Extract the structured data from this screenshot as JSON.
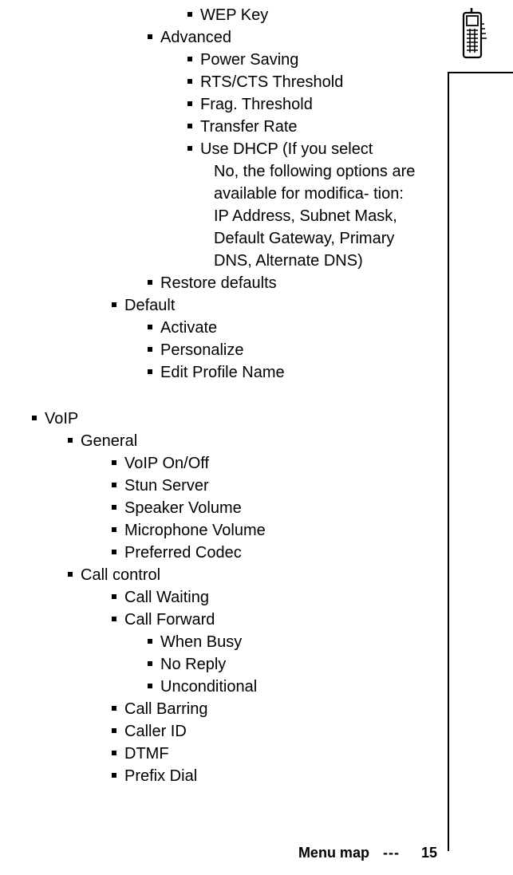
{
  "top": {
    "l4": [
      "WEP Key"
    ],
    "advanced_label": "Advanced",
    "advanced_items": [
      "Power Saving",
      "RTS/CTS Threshold",
      "Frag. Threshold",
      "Transfer Rate"
    ],
    "dhcp_line1": "Use DHCP (If you select",
    "dhcp_cont": [
      "No, the following options are",
      "available for modifica- tion:",
      "IP Address, Subnet Mask,",
      "Default Gateway, Primary",
      "DNS, Alternate DNS)"
    ],
    "restore_label": "Restore defaults",
    "default_label": "Default",
    "default_items": [
      "Activate",
      "Personalize",
      "Edit Profile Name"
    ]
  },
  "voip": {
    "title": "VoIP",
    "general_label": "General",
    "general_items": [
      "VoIP On/Off",
      "Stun Server",
      "Speaker Volume",
      "Microphone Volume",
      "Preferred Codec"
    ],
    "callcontrol_label": "Call control",
    "cc_before": [
      "Call Waiting",
      "Call Forward"
    ],
    "cc_sub": [
      "When Busy",
      "No Reply",
      "Unconditional"
    ],
    "cc_after": [
      "Call Barring",
      "Caller ID",
      "DTMF",
      "Prefix Dial"
    ]
  },
  "footer": {
    "title": "Menu map",
    "sep": "---",
    "page": "15"
  }
}
